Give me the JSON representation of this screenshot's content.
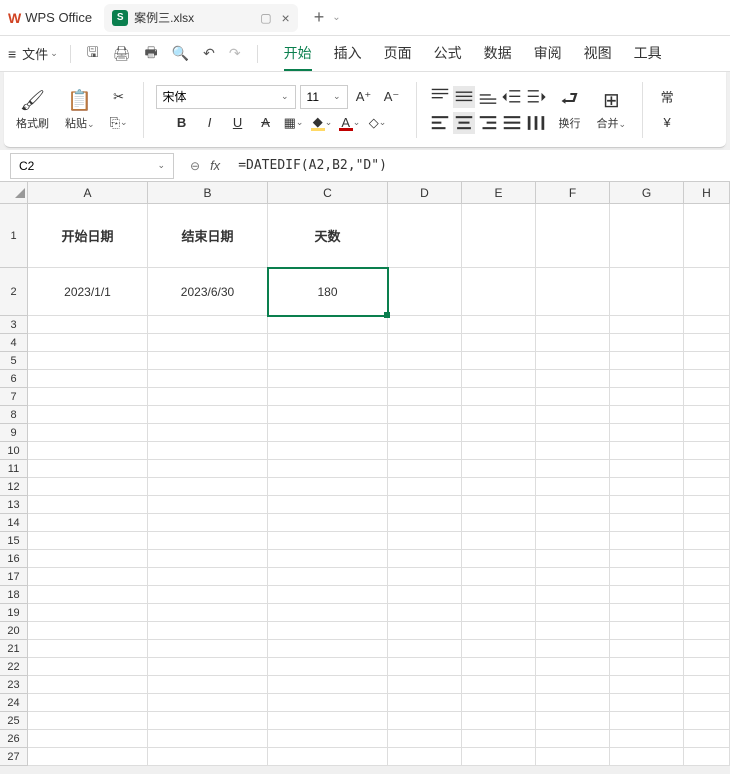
{
  "app": {
    "name": "WPS Office"
  },
  "tab": {
    "icon": "S",
    "filename": "案例三.xlsx"
  },
  "menubar": {
    "file": "文件",
    "tabs": [
      "开始",
      "插入",
      "页面",
      "公式",
      "数据",
      "审阅",
      "视图",
      "工具"
    ],
    "active_index": 0
  },
  "ribbon": {
    "format_painter": "格式刷",
    "paste": "粘贴",
    "font_name": "宋体",
    "font_size": "11",
    "wrap": "换行",
    "merge": "合并",
    "currency": "常",
    "yen": "¥"
  },
  "formula_bar": {
    "cell_ref": "C2",
    "fx": "fx",
    "formula": "=DATEDIF(A2,B2,\"D\")"
  },
  "sheet": {
    "columns": [
      "A",
      "B",
      "C",
      "D",
      "E",
      "F",
      "G",
      "H"
    ],
    "row_count": 27,
    "header_row_height": 64,
    "data_row_height": 48,
    "normal_row_height": 18,
    "headers": {
      "A": "开始日期",
      "B": "结束日期",
      "C": "天数"
    },
    "data": {
      "A": "2023/1/1",
      "B": "2023/6/30",
      "C": "180"
    },
    "selected": "C2"
  },
  "chart_data": {
    "type": "table",
    "columns": [
      "开始日期",
      "结束日期",
      "天数"
    ],
    "rows": [
      [
        "2023/1/1",
        "2023/6/30",
        180
      ]
    ]
  }
}
